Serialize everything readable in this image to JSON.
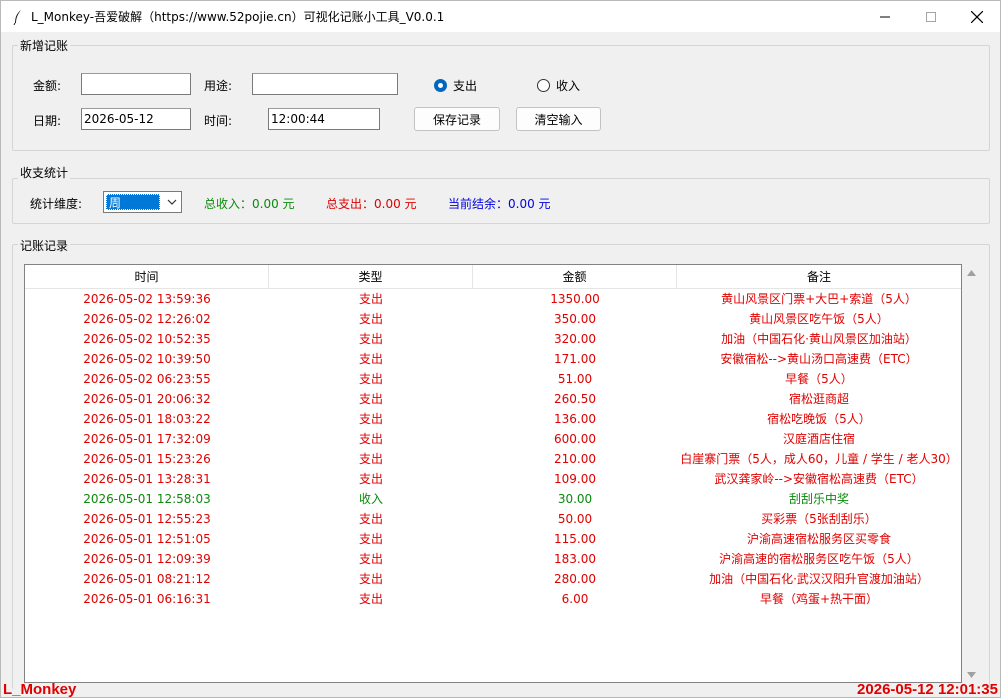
{
  "window": {
    "title": "L_Monkey-吾爱破解（https://www.52pojie.cn）可视化记账小工具_V0.0.1"
  },
  "add_group": {
    "title": "新增记账",
    "amount_label": "金额:",
    "amount_value": "",
    "purpose_label": "用途:",
    "purpose_value": "",
    "date_label": "日期:",
    "date_value": "2026-05-12",
    "time_label": "时间:",
    "time_value": "12:00:44",
    "radio_expense": "支出",
    "radio_income": "收入",
    "selected_type": "支出",
    "save_button": "保存记录",
    "clear_button": "清空输入"
  },
  "stats_group": {
    "title": "收支统计",
    "dimension_label": "统计维度:",
    "dimension_value": "周",
    "total_income": "总收入：0.00 元",
    "total_expense": "总支出：0.00 元",
    "balance": "当前结余：0.00 元",
    "colors": {
      "income": "#0a8a0a",
      "expense": "#e00000",
      "balance": "#0000e0"
    }
  },
  "records_group": {
    "title": "记账记录",
    "columns": [
      "时间",
      "类型",
      "金额",
      "备注"
    ],
    "rows": [
      {
        "time": "2026-05-02 13:59:36",
        "type": "支出",
        "amount": "1350.00",
        "note": "黄山风景区门票+大巴+索道（5人）",
        "kind": "expense"
      },
      {
        "time": "2026-05-02 12:26:02",
        "type": "支出",
        "amount": "350.00",
        "note": "黄山风景区吃午饭（5人）",
        "kind": "expense"
      },
      {
        "time": "2026-05-02 10:52:35",
        "type": "支出",
        "amount": "320.00",
        "note": "加油（中国石化·黄山风景区加油站）",
        "kind": "expense"
      },
      {
        "time": "2026-05-02 10:39:50",
        "type": "支出",
        "amount": "171.00",
        "note": "安徽宿松-->黄山汤口高速费（ETC）",
        "kind": "expense"
      },
      {
        "time": "2026-05-02 06:23:55",
        "type": "支出",
        "amount": "51.00",
        "note": "早餐（5人）",
        "kind": "expense"
      },
      {
        "time": "2026-05-01 20:06:32",
        "type": "支出",
        "amount": "260.50",
        "note": "宿松逛商超",
        "kind": "expense"
      },
      {
        "time": "2026-05-01 18:03:22",
        "type": "支出",
        "amount": "136.00",
        "note": "宿松吃晚饭（5人）",
        "kind": "expense"
      },
      {
        "time": "2026-05-01 17:32:09",
        "type": "支出",
        "amount": "600.00",
        "note": "汉庭酒店住宿",
        "kind": "expense"
      },
      {
        "time": "2026-05-01 15:23:26",
        "type": "支出",
        "amount": "210.00",
        "note": "白崖寨门票（5人，成人60，儿童 / 学生 / 老人30）",
        "kind": "expense"
      },
      {
        "time": "2026-05-01 13:28:31",
        "type": "支出",
        "amount": "109.00",
        "note": "武汉龚家岭-->安徽宿松高速费（ETC）",
        "kind": "expense"
      },
      {
        "time": "2026-05-01 12:58:03",
        "type": "收入",
        "amount": "30.00",
        "note": "刮刮乐中奖",
        "kind": "income"
      },
      {
        "time": "2026-05-01 12:55:23",
        "type": "支出",
        "amount": "50.00",
        "note": "买彩票（5张刮刮乐）",
        "kind": "expense"
      },
      {
        "time": "2026-05-01 12:51:05",
        "type": "支出",
        "amount": "115.00",
        "note": "沪渝高速宿松服务区买零食",
        "kind": "expense"
      },
      {
        "time": "2026-05-01 12:09:39",
        "type": "支出",
        "amount": "183.00",
        "note": "沪渝高速的宿松服务区吃午饭（5人）",
        "kind": "expense"
      },
      {
        "time": "2026-05-01 08:21:12",
        "type": "支出",
        "amount": "280.00",
        "note": "加油（中国石化·武汉汉阳升官渡加油站）",
        "kind": "expense"
      },
      {
        "time": "2026-05-01 06:16:31",
        "type": "支出",
        "amount": "6.00",
        "note": "早餐（鸡蛋+热干面）",
        "kind": "expense"
      }
    ]
  },
  "footer": {
    "left": "L_Monkey",
    "right": "2026-05-12 12:01:35"
  }
}
